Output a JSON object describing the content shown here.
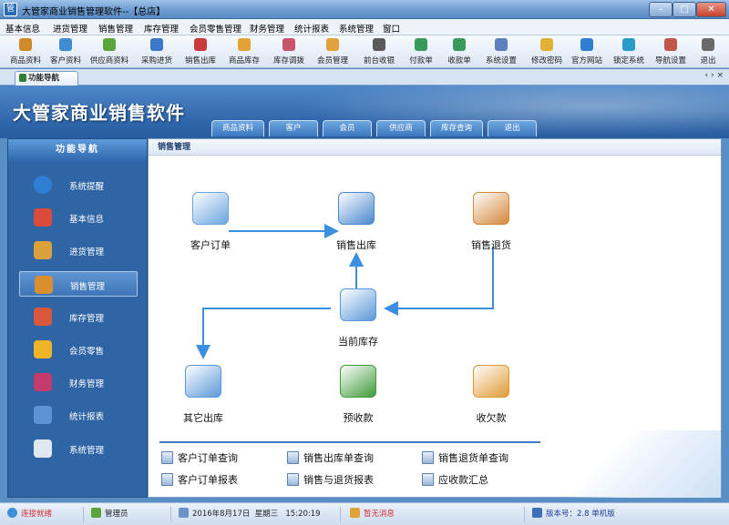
{
  "window": {
    "title": "大管家商业销售管理软件--【总店】",
    "icon_name": "app-icon",
    "controls": [
      "minimize",
      "maximize",
      "close"
    ]
  },
  "menu": [
    {
      "label": "基本信息"
    },
    {
      "label": "进货管理"
    },
    {
      "label": "销售管理"
    },
    {
      "label": "库存管理"
    },
    {
      "label": "会员零售管理"
    },
    {
      "label": "财务管理"
    },
    {
      "label": "统计报表"
    },
    {
      "label": "系统管理"
    },
    {
      "label": "窗口"
    }
  ],
  "toolbar": [
    {
      "label": "商品资料",
      "icon": "product-icon",
      "color": "#d18a2a"
    },
    {
      "label": "客户资料",
      "icon": "customer-icon",
      "color": "#3d8bd1"
    },
    {
      "label": "供应商资料",
      "icon": "supplier-icon",
      "color": "#5aa63a"
    },
    {
      "label": "采购进货",
      "icon": "purchase-icon",
      "color": "#3a79c5"
    },
    {
      "label": "销售出库",
      "icon": "sales-out-icon",
      "color": "#c83b3b"
    },
    {
      "label": "商品库存",
      "icon": "stock-icon",
      "color": "#e2a236"
    },
    {
      "label": "库存调拨",
      "icon": "transfer-icon",
      "color": "#c9536b"
    },
    {
      "label": "会员管理",
      "icon": "member-icon",
      "color": "#e0a23a"
    },
    {
      "label": "前台收银",
      "icon": "cashier-icon",
      "color": "#5a5a5a"
    },
    {
      "label": "付款单",
      "icon": "payment-icon",
      "color": "#3a9a5a"
    },
    {
      "label": "收款单",
      "icon": "receipt-icon",
      "color": "#3a9a5a"
    },
    {
      "label": "系统设置",
      "icon": "settings-icon",
      "color": "#5b7fbf"
    },
    {
      "label": "修改密码",
      "icon": "password-icon",
      "color": "#e3b13a"
    },
    {
      "label": "官方网站",
      "icon": "website-icon",
      "color": "#2f7fd0"
    },
    {
      "label": "锁定系统",
      "icon": "lock-icon",
      "color": "#2a9ac8"
    },
    {
      "label": "导航设置",
      "icon": "nav-settings-icon",
      "color": "#c0584a"
    },
    {
      "label": "退出",
      "icon": "exit-icon",
      "color": "#6a6a6a"
    }
  ],
  "nav_tab": {
    "label": "功能导航"
  },
  "banner": {
    "title": "大管家商业销售软件",
    "tabs": [
      {
        "label": "商品资料"
      },
      {
        "label": "客户"
      },
      {
        "label": "会员"
      },
      {
        "label": "供应商"
      },
      {
        "label": "库存查询"
      },
      {
        "label": "退出"
      }
    ]
  },
  "sidebar": {
    "header": "功能导航",
    "items": [
      {
        "label": "系统提醒",
        "icon": "info-icon",
        "color": "#2f7fd6",
        "active": false
      },
      {
        "label": "基本信息",
        "icon": "cubes-icon",
        "color": "#d94b3c",
        "active": false
      },
      {
        "label": "进货管理",
        "icon": "box-icon",
        "color": "#d9a13a",
        "active": false
      },
      {
        "label": "销售管理",
        "icon": "open-box-icon",
        "color": "#d98f2e",
        "active": true
      },
      {
        "label": "库存管理",
        "icon": "warehouse-icon",
        "color": "#d9573a",
        "active": false
      },
      {
        "label": "会员零售",
        "icon": "members-icon",
        "color": "#f0b429",
        "active": false
      },
      {
        "label": "财务管理",
        "icon": "finance-icon",
        "color": "#c33b6b",
        "active": false
      },
      {
        "label": "统计报表",
        "icon": "report-icon",
        "color": "#5c93d6",
        "active": false
      },
      {
        "label": "系统管理",
        "icon": "gears-icon",
        "color": "#dfe7f1",
        "active": false
      }
    ]
  },
  "main": {
    "header": "销售管理",
    "nodes": [
      {
        "key": "customer_order",
        "label": "客户订单",
        "icon": "customer-order-icon",
        "color": "#6ba4de"
      },
      {
        "key": "sales_out",
        "label": "销售出库",
        "icon": "sales-out-truck-icon",
        "color": "#4a86cf"
      },
      {
        "key": "sales_return",
        "label": "销售退货",
        "icon": "sales-return-icon",
        "color": "#d2873a"
      },
      {
        "key": "current_stock",
        "label": "当前库存",
        "icon": "current-stock-icon",
        "color": "#5b98d8"
      },
      {
        "key": "other_out",
        "label": "其它出库",
        "icon": "other-out-icon",
        "color": "#5b98d8"
      },
      {
        "key": "prepayment",
        "label": "预收款",
        "icon": "prepayment-icon",
        "color": "#3f9a3a"
      },
      {
        "key": "receivable",
        "label": "收欠款",
        "icon": "receivable-icon",
        "color": "#e09a34"
      }
    ],
    "links": [
      {
        "label": "客户订单查询",
        "icon": "doc-search-icon"
      },
      {
        "label": "销售出库单查询",
        "icon": "doc-search-icon"
      },
      {
        "label": "销售退货单查询",
        "icon": "doc-search-icon"
      },
      {
        "label": "客户订单报表",
        "icon": "doc-report-icon"
      },
      {
        "label": "销售与退货报表",
        "icon": "doc-report-icon"
      },
      {
        "label": "应收款汇总",
        "icon": "doc-report-icon"
      }
    ]
  },
  "status": {
    "connection": "连接就绪",
    "user": "管理员",
    "date": "2016年8月17日",
    "weekday": "星期三",
    "time": "15:20:19",
    "message": "暂无消息",
    "version": "版本号：2.8 单机版"
  },
  "colors": {
    "frame_blue": "#5a8fc6",
    "sidebar_blue": "#2f64a5",
    "flow_arrow": "#3b8fe0",
    "status_red": "#d32f2f"
  }
}
